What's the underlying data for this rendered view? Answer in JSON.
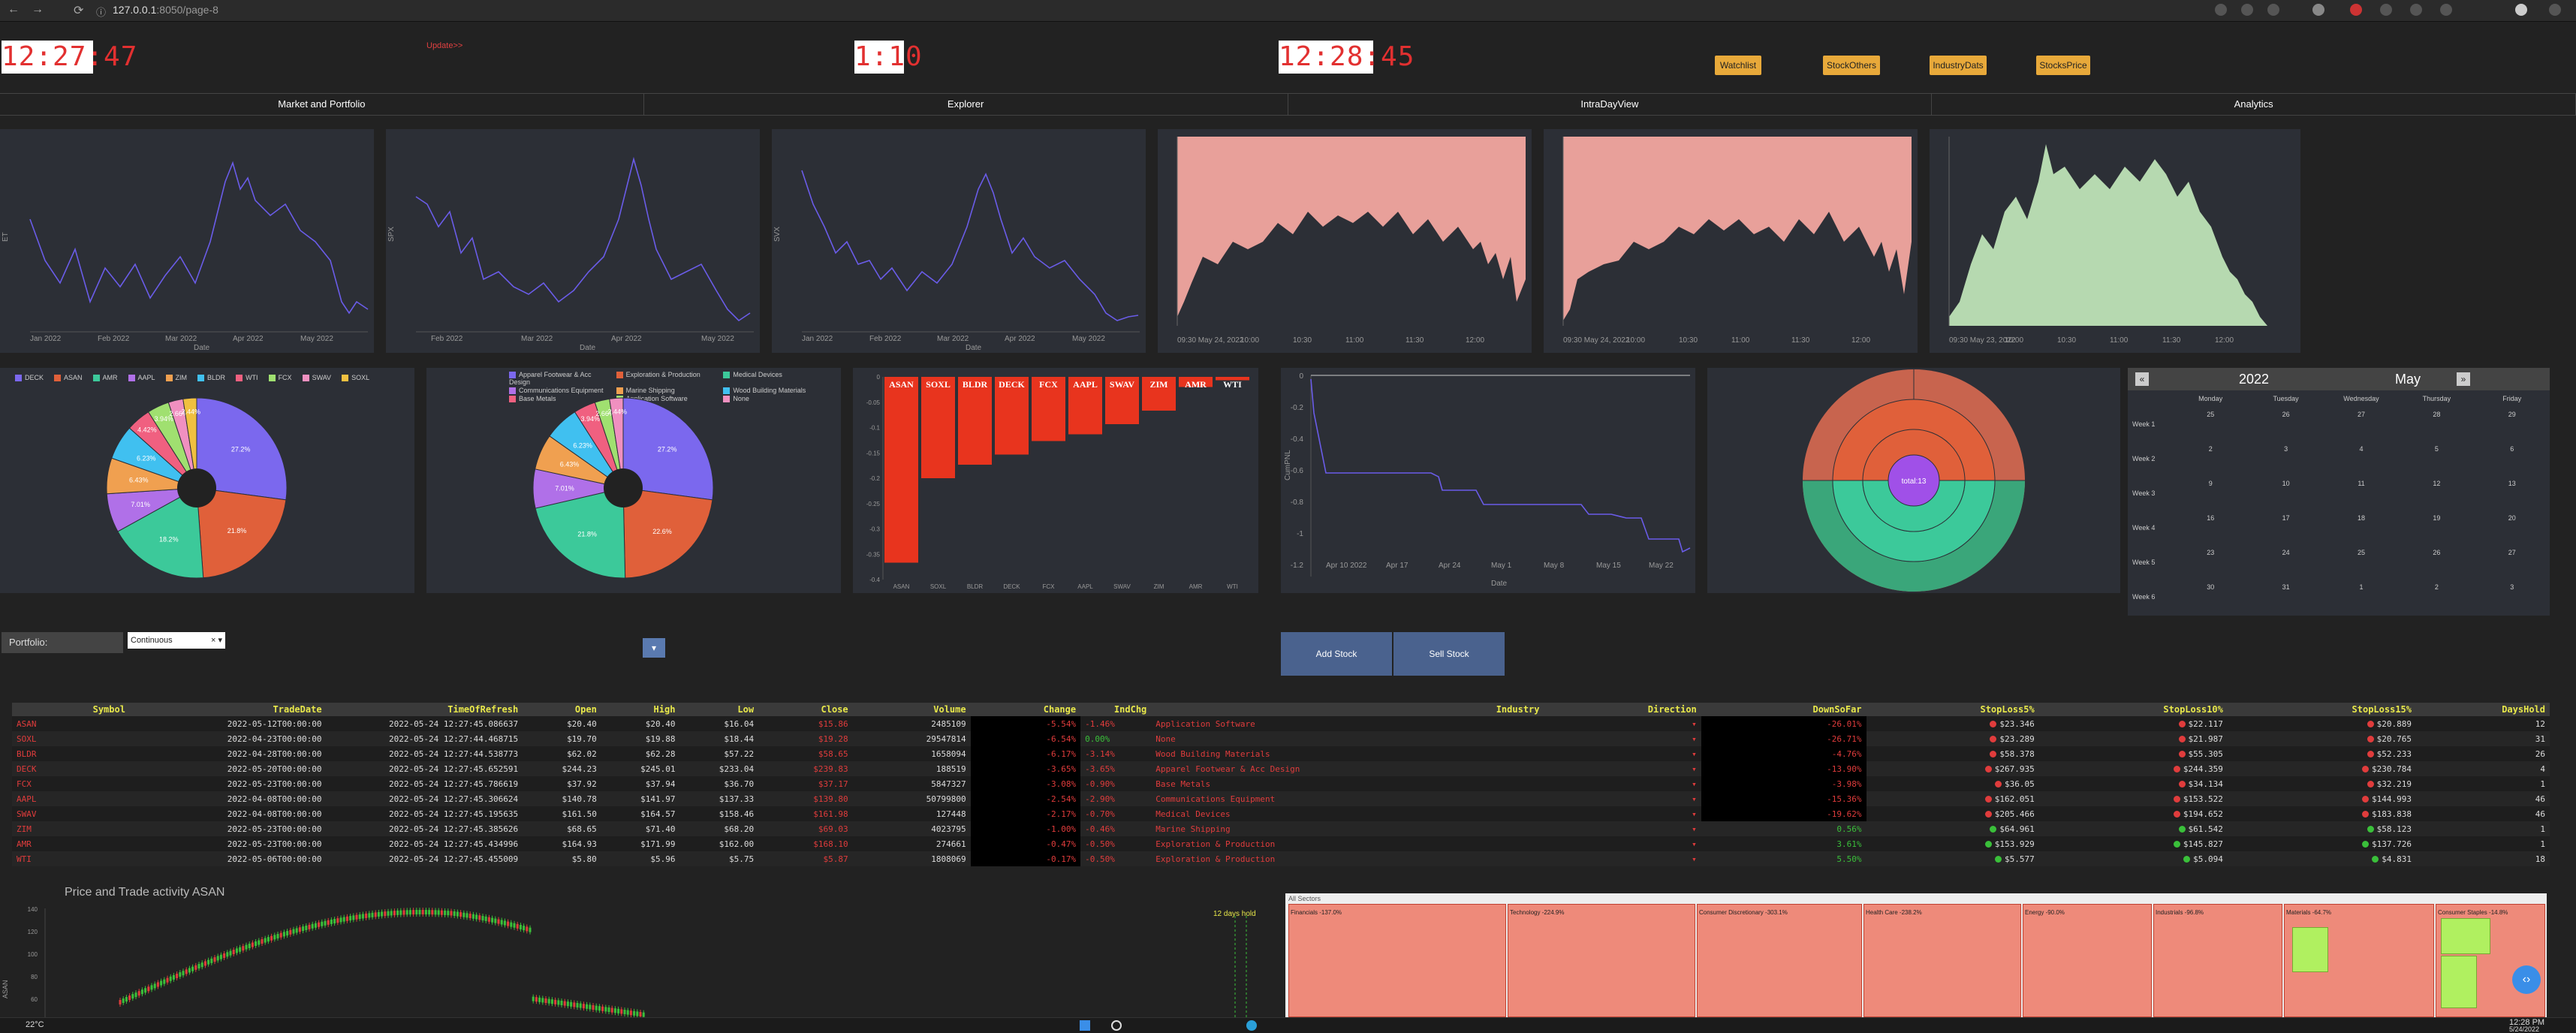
{
  "browser": {
    "host": "127.0.0.1",
    "port_path": ":8050/page-8",
    "back": "←",
    "forward": "→",
    "reload": "⟳",
    "info": "ⓘ"
  },
  "header": {
    "clock1": "12:27:47",
    "update_link": "Update>>",
    "clock2": "1:10",
    "clock3": "12:28:45",
    "buttons": [
      "Watchlist",
      "StockOthers",
      "IndustryDats",
      "StocksPrice"
    ]
  },
  "tabs": [
    "Market and Portfolio",
    "Explorer",
    "IntraDayView",
    "Analytics"
  ],
  "line_charts": [
    {
      "ylabel": "ET",
      "xlabel": "Date",
      "xticks": [
        "Jan 2022",
        "Feb 2022",
        "Mar 2022",
        "Apr 2022",
        "May 2022"
      ]
    },
    {
      "ylabel": "SPX",
      "xlabel": "Date",
      "xticks": [
        "Feb 2022",
        "Mar 2022",
        "Apr 2022",
        "May 2022"
      ]
    },
    {
      "ylabel": "SVX",
      "xlabel": "Date",
      "xticks": [
        "Jan 2022",
        "Feb 2022",
        "Mar 2022",
        "Apr 2022",
        "May 2022"
      ]
    }
  ],
  "intraday_charts": [
    {
      "xticks": [
        "09:30\nMay 24, 2022",
        "10:00",
        "10:30",
        "11:00",
        "11:30",
        "12:00"
      ],
      "color": "#e8a09a"
    },
    {
      "xticks": [
        "09:30\nMay 24, 2022",
        "10:00",
        "10:30",
        "11:00",
        "11:30",
        "12:00"
      ],
      "color": "#e8a09a"
    },
    {
      "xticks": [
        "09:30\nMay 23, 2022",
        "10:00",
        "10:30",
        "11:00",
        "11:30",
        "12:00"
      ],
      "color": "#b6d9b0"
    }
  ],
  "pie1": {
    "legend": [
      "DECK",
      "ASAN",
      "AMR",
      "AAPL",
      "ZIM",
      "BLDR",
      "WTI",
      "FCX",
      "SWAV",
      "SOXL"
    ],
    "colors": [
      "#7b68ee",
      "#e0603a",
      "#3cc99a",
      "#b070e8",
      "#f0a050",
      "#40c0f0",
      "#f06080",
      "#a0e070",
      "#f090c0",
      "#f0c040"
    ],
    "labels": [
      "27.2%",
      "21.8%",
      "18.2%",
      "7.01%",
      "6.43%",
      "6.23%",
      "4.42%",
      "3.94%",
      "2.66%",
      "2.44%"
    ],
    "chart_data": {
      "type": "pie",
      "categories": [
        "DECK",
        "ASAN",
        "AMR",
        "AAPL",
        "ZIM",
        "BLDR",
        "WTI",
        "FCX",
        "SWAV",
        "SOXL"
      ],
      "values": [
        27.2,
        21.8,
        18.2,
        7.01,
        6.43,
        6.23,
        4.42,
        3.94,
        2.66,
        2.44
      ]
    }
  },
  "pie2": {
    "legend": [
      "Apparel Footwear & Acc Design",
      "Exploration & Production",
      "Medical Devices",
      "Communications Equipment",
      "Marine Shipping",
      "Wood Building Materials",
      "Base Metals",
      "Application Software",
      "None"
    ],
    "colors": [
      "#7b68ee",
      "#e0603a",
      "#3cc99a",
      "#b070e8",
      "#f0a050",
      "#40c0f0",
      "#f06080",
      "#a0e070",
      "#f090c0"
    ],
    "labels": [
      "27.2%",
      "22.6%",
      "21.8%",
      "7.01%",
      "6.43%",
      "6.23%",
      "3.94%",
      "2.66%",
      "2.44%"
    ]
  },
  "bar_chart": {
    "chart_data": {
      "type": "bar",
      "categories": [
        "ASAN",
        "SOXL",
        "BLDR",
        "DECK",
        "FCX",
        "AAPL",
        "SWAV",
        "ZIM",
        "AMR",
        "WTI"
      ],
      "values": [
        -5.5,
        -3.0,
        -2.6,
        -2.3,
        -1.9,
        -1.7,
        -1.4,
        -1.0,
        -0.3,
        -0.1
      ],
      "ylim": [
        -6,
        0
      ]
    },
    "yticks": [
      "0",
      "-0.05",
      "-0.1",
      "-0.15",
      "-0.2",
      "-0.25",
      "-0.3",
      "-0.35",
      "-0.4"
    ]
  },
  "cum_chart": {
    "ylabel": "CumPNL",
    "xlabel": "Date",
    "xticks": [
      "Apr 10\n2022",
      "Apr 17",
      "Apr 24",
      "May 1",
      "May 8",
      "May 15",
      "May 22"
    ],
    "yticks": [
      "0",
      "-0.2",
      "-0.4",
      "-0.6",
      "-0.8",
      "-1",
      "-1.2"
    ]
  },
  "sunburst": {
    "center": "total:13"
  },
  "calendar": {
    "year": "2022",
    "month": "May",
    "prev": "«",
    "next": "»",
    "days": [
      "Monday",
      "Tuesday",
      "Wednesday",
      "Thursday",
      "Friday"
    ],
    "weeks": [
      {
        "label": "Week 1",
        "cells": [
          "25",
          "26",
          "27",
          "28",
          "29"
        ]
      },
      {
        "label": "Week 2",
        "cells": [
          "2",
          "3",
          "4",
          "5",
          "6"
        ]
      },
      {
        "label": "Week 3",
        "cells": [
          "9",
          "10",
          "11",
          "12",
          "13"
        ]
      },
      {
        "label": "Week 4",
        "cells": [
          "16",
          "17",
          "18",
          "19",
          "20"
        ]
      },
      {
        "label": "Week 5",
        "cells": [
          "23",
          "24",
          "25",
          "26",
          "27"
        ]
      },
      {
        "label": "Week 6",
        "cells": [
          "30",
          "31",
          "1",
          "2",
          "3"
        ]
      }
    ]
  },
  "portfolio": {
    "label": "Portfolio:",
    "select": "Continuous",
    "add": "Add Stock",
    "sell": "Sell Stock"
  },
  "table": {
    "columns": [
      "Symbol",
      "TradeDate",
      "TimeOfRefresh",
      "Open",
      "High",
      "Low",
      "Close",
      "Volume",
      "Change",
      "IndChg",
      "Industry",
      "Direction",
      "DownSoFar",
      "StopLoss5%",
      "StopLoss10%",
      "StopLoss15%",
      "DaysHold"
    ],
    "rows": [
      [
        "ASAN",
        "2022-05-12T00:00:00",
        "2022-05-24 12:27:45.086637",
        "$20.40",
        "$20.40",
        "$16.04",
        "$15.86",
        "2485109",
        "-5.54%",
        "-1.46%",
        "Application Software",
        "▾",
        "-26.01%",
        "$23.346",
        "$22.117",
        "$20.889",
        "12"
      ],
      [
        "SOXL",
        "2022-04-23T00:00:00",
        "2022-05-24 12:27:44.468715",
        "$19.70",
        "$19.88",
        "$18.44",
        "$19.28",
        "29547814",
        "-6.54%",
        "0.00%",
        "None",
        "▾",
        "-26.71%",
        "$23.289",
        "$21.987",
        "$20.765",
        "31"
      ],
      [
        "BLDR",
        "2022-04-28T00:00:00",
        "2022-05-24 12:27:44.538773",
        "$62.02",
        "$62.28",
        "$57.22",
        "$58.65",
        "1658094",
        "-6.17%",
        "-3.14%",
        "Wood Building Materials",
        "▾",
        "-4.76%",
        "$58.378",
        "$55.305",
        "$52.233",
        "26"
      ],
      [
        "DECK",
        "2022-05-20T00:00:00",
        "2022-05-24 12:27:45.652591",
        "$244.23",
        "$245.01",
        "$233.04",
        "$239.83",
        "188519",
        "-3.65%",
        "-3.65%",
        "Apparel Footwear & Acc Design",
        "▾",
        "-13.90%",
        "$267.935",
        "$244.359",
        "$230.784",
        "4"
      ],
      [
        "FCX",
        "2022-05-23T00:00:00",
        "2022-05-24 12:27:45.786619",
        "$37.92",
        "$37.94",
        "$36.70",
        "$37.17",
        "5847327",
        "-3.08%",
        "-0.90%",
        "Base Metals",
        "▾",
        "-3.98%",
        "$36.05",
        "$34.134",
        "$32.219",
        "1"
      ],
      [
        "AAPL",
        "2022-04-08T00:00:00",
        "2022-05-24 12:27:45.306624",
        "$140.78",
        "$141.97",
        "$137.33",
        "$139.80",
        "50799800",
        "-2.54%",
        "-2.90%",
        "Communications Equipment",
        "▾",
        "-15.36%",
        "$162.051",
        "$153.522",
        "$144.993",
        "46"
      ],
      [
        "SWAV",
        "2022-04-08T00:00:00",
        "2022-05-24 12:27:45.195635",
        "$161.50",
        "$164.57",
        "$158.46",
        "$161.98",
        "127448",
        "-2.17%",
        "-0.70%",
        "Medical Devices",
        "▾",
        "-19.62%",
        "$205.466",
        "$194.652",
        "$183.838",
        "46"
      ],
      [
        "ZIM",
        "2022-05-23T00:00:00",
        "2022-05-24 12:27:45.385626",
        "$68.65",
        "$71.40",
        "$68.20",
        "$69.03",
        "4023795",
        "-1.00%",
        "-0.46%",
        "Marine Shipping",
        "▾",
        "0.56%",
        "$64.961",
        "$61.542",
        "$58.123",
        "1"
      ],
      [
        "AMR",
        "2022-05-23T00:00:00",
        "2022-05-24 12:27:45.434996",
        "$164.93",
        "$171.99",
        "$162.00",
        "$168.10",
        "274661",
        "-0.47%",
        "-0.50%",
        "Exploration & Production",
        "▾",
        "3.61%",
        "$153.929",
        "$145.827",
        "$137.726",
        "1"
      ],
      [
        "WTI",
        "2022-05-06T00:00:00",
        "2022-05-24 12:27:45.455009",
        "$5.80",
        "$5.96",
        "$5.75",
        "$5.87",
        "1808069",
        "-0.17%",
        "-0.50%",
        "Exploration & Production",
        "▾",
        "5.50%",
        "$5.577",
        "$5.094",
        "$4.831",
        "18"
      ]
    ]
  },
  "candle": {
    "title": "Price and Trade activity ASAN",
    "ylabel": "ASAN",
    "yticks": [
      "140",
      "120",
      "100",
      "80",
      "60"
    ],
    "marker": "12 days hold"
  },
  "treemap": {
    "root": "All Sectors",
    "sectors": [
      {
        "name": "Financials -137.0%",
        "color": "#ee8a7a"
      },
      {
        "name": "Technology -224.9%",
        "color": "#ee8a7a"
      },
      {
        "name": "Consumer Discretionary -303.1%",
        "color": "#ee8a7a"
      },
      {
        "name": "Health Care -238.2%",
        "color": "#ee8a7a"
      },
      {
        "name": "Energy -90.0%",
        "color": "#ee8a7a"
      },
      {
        "name": "Industrials -96.8%",
        "color": "#ee8a7a"
      },
      {
        "name": "Materials -64.7%",
        "color": "#ee8a7a"
      },
      {
        "name": "Consumer Staples -14.8%",
        "color": "#ee8a7a"
      }
    ]
  },
  "taskbar": {
    "weather": "22°C",
    "time": "12:28 PM",
    "date": "5/24/2022"
  }
}
